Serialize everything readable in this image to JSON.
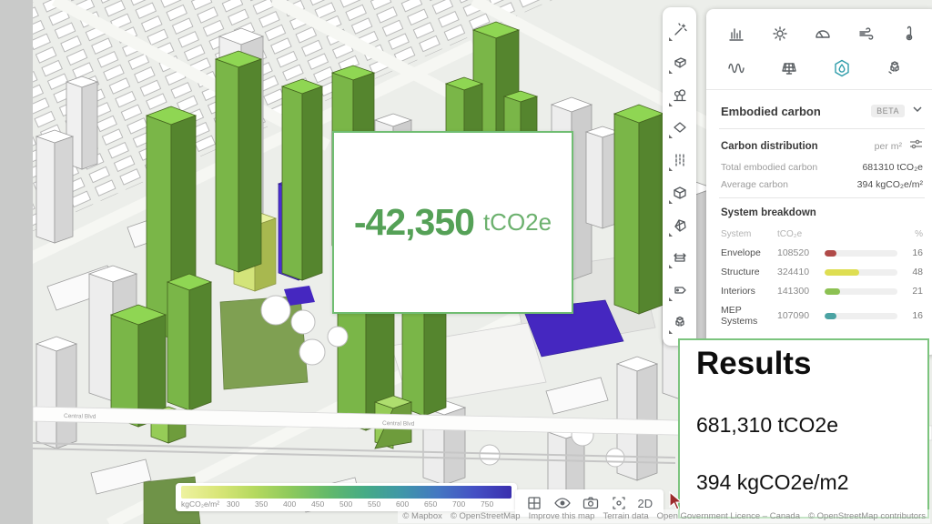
{
  "colors": {
    "accent_green": "#55a157",
    "border_green": "#70bd72",
    "highlight_teal": "#2f9daa",
    "tower_green_light": "#7ab648",
    "tower_green_dark": "#55852e",
    "purple_parcel": "#4527c0",
    "left_band_gray": "#c9cac9"
  },
  "overlay_card": {
    "value": "-42,350",
    "unit": "tCO2e"
  },
  "results": {
    "title": "Results",
    "line1": "681,310 tCO2e",
    "line2": "394 kgCO2e/m2"
  },
  "panel": {
    "title": "Embodied carbon",
    "beta": "BETA",
    "distribution": {
      "label": "Carbon distribution",
      "per": "per m²"
    },
    "stats": [
      {
        "label": "Total embodied carbon",
        "value": "681310 tCO₂e"
      },
      {
        "label": "Average carbon",
        "value": "394 kgCO₂e/m²"
      }
    ],
    "breakdown": {
      "title": "System breakdown",
      "headers": {
        "system": "System",
        "tco2e": "tCO₂e",
        "pct": "%"
      },
      "rows": [
        {
          "name": "Envelope",
          "value": "108520",
          "pct": 16,
          "color": "#b04a48"
        },
        {
          "name": "Structure",
          "value": "324410",
          "pct": 48,
          "color": "#dede52"
        },
        {
          "name": "Interiors",
          "value": "141300",
          "pct": 21,
          "color": "#8cc152"
        },
        {
          "name": "MEP Systems",
          "value": "107090",
          "pct": 16,
          "color": "#4ba3a3"
        }
      ]
    }
  },
  "top_icons": {
    "row1": [
      "statistics",
      "sun",
      "sun-hours-dome",
      "wind",
      "thermometer"
    ],
    "row2": [
      "noise-wave",
      "solar-panel",
      "embodied-carbon-drop",
      "massing-blocks"
    ],
    "active": "embodied-carbon-drop"
  },
  "left_toolbar_icons": [
    "ai-wand",
    "building-block",
    "vegetation-trees",
    "parcel-plane",
    "road-lines",
    "volume-cube",
    "terrain-polyhedron",
    "measure-arrows",
    "label-tag",
    "blocks-cluster"
  ],
  "legend": {
    "unit": "kgCO₂e/m²",
    "ticks": [
      "300",
      "350",
      "400",
      "450",
      "500",
      "550",
      "600",
      "650",
      "700",
      "750"
    ],
    "colors": [
      "#eef2a0",
      "#d9e678",
      "#b5d95f",
      "#8cc95c",
      "#63b96a",
      "#45ab85",
      "#3f97a8",
      "#4477c2",
      "#4450c4",
      "#3a2fae"
    ]
  },
  "bottom_toolbar": {
    "mode_label": "2D",
    "icons": [
      "grid-view",
      "visibility-eye",
      "camera-snapshot",
      "focus-target"
    ]
  },
  "map": {
    "street_labels": [
      "Central Blvd",
      "Central Blvd"
    ],
    "attribution_parts": [
      "© Mapbox",
      "© OpenStreetMap",
      "Improve this map",
      "Terrain data",
      "Open Government Licence – Canada",
      "© OpenStreetMap contributors"
    ]
  }
}
